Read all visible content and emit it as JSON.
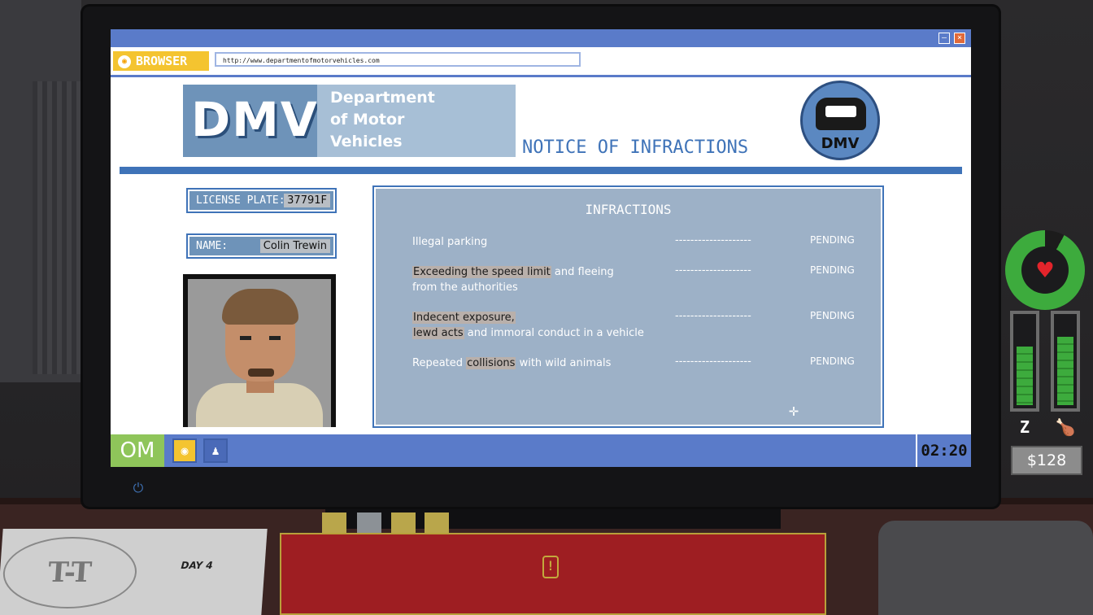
{
  "browser": {
    "tag_label": "BROWSER",
    "url": "http://www.departmentofmotorvehicles.com",
    "minimize_glyph": "–",
    "close_glyph": "×"
  },
  "page": {
    "logo_abbr": "DMV",
    "logo_lines": [
      "Department",
      "of Motor",
      "Vehicles"
    ],
    "notice_title": "NOTICE OF INFRACTIONS",
    "badge_text": "DMV"
  },
  "record": {
    "plate_label": "LICENSE PLATE:",
    "plate_value": "37791F",
    "name_label": "NAME:",
    "name_value": "Colin Trewin"
  },
  "infractions": {
    "heading": "INFRACTIONS",
    "dash": "--------------------",
    "items": [
      {
        "line1_pre": "",
        "line1_hl": "",
        "line1_post": "Illegal parking",
        "line2_hl": "",
        "line2_post": "",
        "status": "PENDING"
      },
      {
        "line1_pre": "",
        "line1_hl": "Exceeding the speed limit",
        "line1_post": " and fleeing",
        "line2_hl": "",
        "line2_post": "from the authorities",
        "status": "PENDING"
      },
      {
        "line1_pre": "",
        "line1_hl": "Indecent exposure,",
        "line1_post": "",
        "line2_hl": "lewd acts",
        "line2_post": " and immoral conduct in a vehicle",
        "status": "PENDING"
      },
      {
        "line1_pre": "Repeated ",
        "line1_hl": "collisions",
        "line1_post": " with wild animals",
        "line2_hl": "",
        "line2_post": "",
        "status": "PENDING"
      }
    ]
  },
  "taskbar": {
    "start_label": "OM",
    "clock": "02:20"
  },
  "hud": {
    "health_fraction": 0.92,
    "sleep_fraction": 0.62,
    "hunger_fraction": 0.72,
    "money": "$128",
    "sleep_icon": "zz-icon",
    "hunger_icon": "drumstick-icon",
    "heart_icon": "heart-icon"
  },
  "desk": {
    "newspaper_logo": "T-T",
    "newspaper_day": "DAY 4"
  },
  "colors": {
    "accent_blue": "#3f73b8",
    "titlebar": "#5a7bc9",
    "browser_tag": "#f4c430",
    "health_green": "#3dab3d",
    "notebook_red": "#9e1e22"
  }
}
